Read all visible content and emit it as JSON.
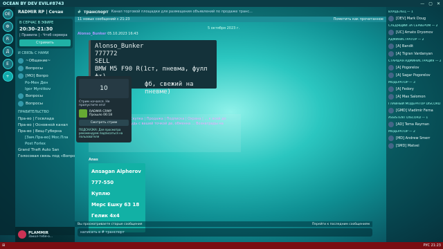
{
  "window": {
    "title": "OCEAN BY DEV EVIL#8743",
    "controls": [
      "—",
      "▢",
      "✕"
    ]
  },
  "guilds": [
    "ОЕ",
    "Ф",
    "R",
    "Д",
    "Е"
  ],
  "sidebar": {
    "server_name": "RADMIR RP | Сечан",
    "event": {
      "category": "В СЕРЧАС В ЭФИРЕ",
      "time": "20:30–21:30",
      "label": "| Правила | - Чтоб сервера",
      "button": "Стримить"
    },
    "categories": [
      {
        "name": "И СВЯЗЬ С НАМИ",
        "channels": [
          "~Общение~",
          "Вопросы",
          "[МО] Вопро",
          "Вопросы",
          "Вопросы"
        ]
      },
      {
        "name": "ПРАВИТЕЛЬСТВО",
        "channels": [
          "Пра-во | Госвлада",
          "Пра-во | Основной канал",
          "Пра-во | Вещ-Губерна",
          "[Зам.Пра-во] Мос.Пла",
          "Post Forlex"
        ]
      }
    ],
    "sub_items": [
      "Ро-Мен Ден",
      "Igor Mynitkov",
      "Вопросы"
    ],
    "game": "Grand Theft Auto San",
    "voice": "Голосовая связь под «Вопросы | RADMIR Р...»"
  },
  "user": {
    "name": "PLAMMIR",
    "status": "Закол-тебя-о..."
  },
  "channel": {
    "name": "транспорт",
    "description": "Канал торговой площадки для размещения объявлений по продаже транс..."
  },
  "new_messages": {
    "text": "11 новых сообщений с 21:23",
    "mark": "Пометить как прочитанное"
  },
  "date_separator": "5 октября 2023 г.",
  "messages": {
    "first_author": "Alonso_Bunker",
    "first_time": "05.10.2023 16:43",
    "card_lines": [
      "Alonso_Bunker",
      "777772",
      "SELL",
      "BMW M5 F90 R(1ст, пневма, фулл фт)",
      "фб, свежий на пневме)"
    ],
    "second_author": "Anas",
    "second_card": [
      "Ansagan Alpherov",
      "777-550",
      "Куплю",
      "Мерс Ешку 63 18",
      "Гелик 4х4"
    ],
    "mid_card": "Alonso_Bunker, Скупка | Продажа | Подписка | Охрана | ... к всей до лыю на что-нибудь с вашей точкой де, обменна ... Вознаграды на только на мыл"
  },
  "popup": {
    "banner": "10",
    "text": "Стрим начался. Не пропустите его!",
    "game": "RADMIR CRMP",
    "time": "Прошло 06:18",
    "button": "Смотреть стрим",
    "footer": "ПОДСКАЗКА: Для просмотра рекомендуем подписаться на пользователя"
  },
  "reply_bar": {
    "left": "Вы просматриваете старые сообщения",
    "right": "Перейти к последним сообщениям"
  },
  "composer": {
    "placeholder": "написать в # транспорт"
  },
  "members": [
    {
      "cat": "ВЛАДЕЛЕЦ — 1",
      "list": [
        "[DEV] Mark Doug"
      ]
    },
    {
      "cat": "СЛЕДЯЩИЙ ЗА СЕРВЕРОМ — 2",
      "list": [
        "[UC] Amato Dryomov"
      ]
    },
    {
      "cat": "АДМИНИСТРАТОР — 2",
      "list": [
        "[A] Bandit",
        "[A] Tigran Vardanyan"
      ]
    },
    {
      "cat": "СТАРШАЯ АДМИНИСТРАЦИЯ — 2",
      "list": [
        "[A] Pogorelov",
        "[A] Sagar Pogorelov"
      ]
    },
    {
      "cat": "МОДЕРАТОР — 3",
      "list": [
        "[A] Fedory",
        "[A] Max Salomon"
      ]
    },
    {
      "cat": "ГЛАВНЫЙ МОДЕРАТОР DISCORD — 1",
      "list": [
        "[GMD] Vladimir Ferna"
      ]
    },
    {
      "cat": "ASSISTENT DISCORD — 1",
      "list": [
        "[AD] Tema Rayman"
      ]
    },
    {
      "cat": "МОДЕРАТОР — 2",
      "list": [
        "[MD] Andrew Smerr",
        "[SMD] Matvei"
      ]
    }
  ],
  "taskbar": {
    "tray": "РУС 21:23"
  }
}
